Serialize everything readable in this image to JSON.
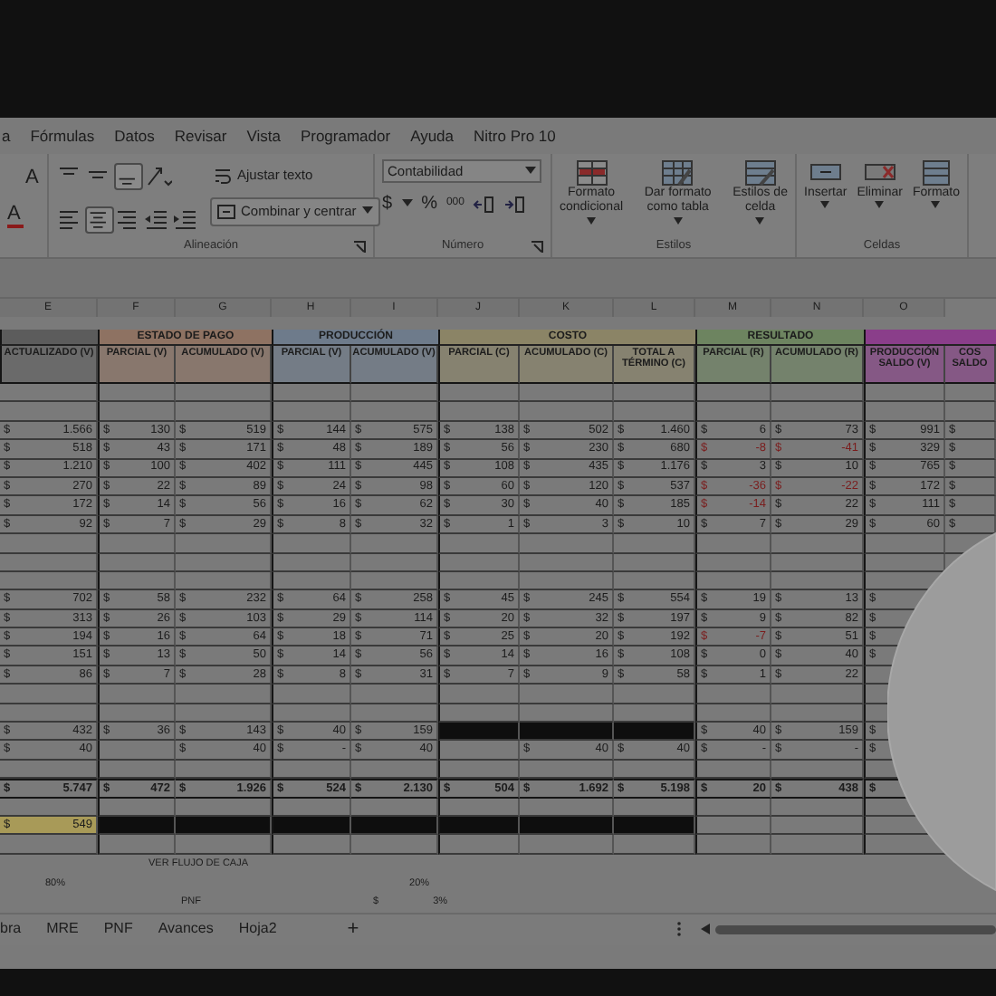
{
  "menu_tabs": [
    "a",
    "Fórmulas",
    "Datos",
    "Revisar",
    "Vista",
    "Programador",
    "Ayuda",
    "Nitro Pro 10"
  ],
  "ribbon": {
    "font_buttons": [
      "A",
      "A"
    ],
    "alignment": {
      "icons": [
        {
          "kind": "top",
          "pressed": false
        },
        {
          "kind": "middle",
          "pressed": false
        },
        {
          "kind": "bottom",
          "pressed": true
        },
        {
          "kind": "orientation",
          "pressed": false
        },
        {
          "kind": "left",
          "pressed": false
        },
        {
          "kind": "center",
          "pressed": true
        },
        {
          "kind": "right",
          "pressed": false
        },
        {
          "kind": "outdent",
          "pressed": false
        },
        {
          "kind": "indent",
          "pressed": false
        }
      ],
      "wrap": "Ajustar texto",
      "merge": "Combinar y centrar",
      "label": "Alineación"
    },
    "number": {
      "format": "Contabilidad",
      "symbols": [
        "$",
        "%",
        "000"
      ],
      "label": "Número"
    },
    "styles": {
      "buttons": [
        [
          "Formato",
          "condicional"
        ],
        [
          "Dar formato",
          "como tabla"
        ],
        [
          "Estilos de",
          "celda"
        ]
      ],
      "label": "Estilos"
    },
    "cells": {
      "buttons": [
        "Insertar",
        "Eliminar",
        "Formato"
      ],
      "label": "Celdas"
    }
  },
  "column_letters": [
    "E",
    "F",
    "G",
    "H",
    "I",
    "J",
    "K",
    "L",
    "M",
    "N",
    "O"
  ],
  "table": {
    "groups": [
      {
        "color": "#5c5c5c",
        "columns": [
          "ACTUALIZADO (V)"
        ]
      },
      {
        "label": "ESTADO DE PAGO",
        "color": "#8e7262",
        "columns": [
          "PARCIAL (V)",
          "ACUMULADO (V)"
        ]
      },
      {
        "label": "PRODUCCIÓN",
        "color": "#6e7b8b",
        "columns": [
          "PARCIAL (V)",
          "ACUMULADO (V)"
        ]
      },
      {
        "label": "COSTO",
        "color": "#8b8466",
        "columns": [
          "PARCIAL (C)",
          "ACUMULADO (C)",
          "TOTAL A TÉRMINO (C)"
        ]
      },
      {
        "label": "RESULTADO",
        "color": "#6d8460",
        "columns": [
          "PARCIAL (R)",
          "ACUMULADO (R)"
        ]
      },
      {
        "color": "#8a3e8a",
        "columns": [
          "PRODUCCIÓN SALDO (V)",
          "COS SALDO"
        ]
      }
    ],
    "rows": [
      {
        "kind": "blank",
        "cells": []
      },
      {
        "kind": "blank",
        "cells": []
      },
      {
        "kind": "data",
        "cells": [
          {
            "symbol": "$",
            "value": "1.566",
            "negative": false
          },
          {
            "symbol": "$",
            "value": "130",
            "negative": false
          },
          {
            "symbol": "$",
            "value": "519",
            "negative": false
          },
          {
            "symbol": "$",
            "value": "144",
            "negative": false
          },
          {
            "symbol": "$",
            "value": "575",
            "negative": false
          },
          {
            "symbol": "$",
            "value": "138",
            "negative": false
          },
          {
            "symbol": "$",
            "value": "502",
            "negative": false
          },
          {
            "symbol": "$",
            "value": "1.460",
            "negative": false
          },
          {
            "symbol": "$",
            "value": "6",
            "negative": false
          },
          {
            "symbol": "$",
            "value": "73",
            "negative": false
          },
          {
            "symbol": "$",
            "value": "991",
            "negative": false
          },
          {
            "symbol": "$",
            "negative": false
          }
        ]
      },
      {
        "kind": "data",
        "cells": [
          {
            "symbol": "$",
            "value": "518",
            "negative": false
          },
          {
            "symbol": "$",
            "value": "43",
            "negative": false
          },
          {
            "symbol": "$",
            "value": "171",
            "negative": false
          },
          {
            "symbol": "$",
            "value": "48",
            "negative": false
          },
          {
            "symbol": "$",
            "value": "189",
            "negative": false
          },
          {
            "symbol": "$",
            "value": "56",
            "negative": false
          },
          {
            "symbol": "$",
            "value": "230",
            "negative": false
          },
          {
            "symbol": "$",
            "value": "680",
            "negative": false
          },
          {
            "symbol": "$",
            "value": "-8",
            "negative": true
          },
          {
            "symbol": "$",
            "value": "-41",
            "negative": true
          },
          {
            "symbol": "$",
            "value": "329",
            "negative": false
          },
          {
            "symbol": "$",
            "negative": false
          }
        ]
      },
      {
        "kind": "data",
        "cells": [
          {
            "symbol": "$",
            "value": "1.210",
            "negative": false
          },
          {
            "symbol": "$",
            "value": "100",
            "negative": false
          },
          {
            "symbol": "$",
            "value": "402",
            "negative": false
          },
          {
            "symbol": "$",
            "value": "111",
            "negative": false
          },
          {
            "symbol": "$",
            "value": "445",
            "negative": false
          },
          {
            "symbol": "$",
            "value": "108",
            "negative": false
          },
          {
            "symbol": "$",
            "value": "435",
            "negative": false
          },
          {
            "symbol": "$",
            "value": "1.176",
            "negative": false
          },
          {
            "symbol": "$",
            "value": "3",
            "negative": false
          },
          {
            "symbol": "$",
            "value": "10",
            "negative": false
          },
          {
            "symbol": "$",
            "value": "765",
            "negative": false
          },
          {
            "symbol": "$",
            "negative": false
          }
        ]
      },
      {
        "kind": "data",
        "cells": [
          {
            "symbol": "$",
            "value": "270",
            "negative": false
          },
          {
            "symbol": "$",
            "value": "22",
            "negative": false
          },
          {
            "symbol": "$",
            "value": "89",
            "negative": false
          },
          {
            "symbol": "$",
            "value": "24",
            "negative": false
          },
          {
            "symbol": "$",
            "value": "98",
            "negative": false
          },
          {
            "symbol": "$",
            "value": "60",
            "negative": false
          },
          {
            "symbol": "$",
            "value": "120",
            "negative": false
          },
          {
            "symbol": "$",
            "value": "537",
            "negative": false
          },
          {
            "symbol": "$",
            "value": "-36",
            "negative": true
          },
          {
            "symbol": "$",
            "value": "-22",
            "negative": true
          },
          {
            "symbol": "$",
            "value": "172",
            "negative": false
          },
          {
            "symbol": "$",
            "negative": false
          }
        ]
      },
      {
        "kind": "data",
        "cells": [
          {
            "symbol": "$",
            "value": "172",
            "negative": false
          },
          {
            "symbol": "$",
            "value": "14",
            "negative": false
          },
          {
            "symbol": "$",
            "value": "56",
            "negative": false
          },
          {
            "symbol": "$",
            "value": "16",
            "negative": false
          },
          {
            "symbol": "$",
            "value": "62",
            "negative": false
          },
          {
            "symbol": "$",
            "value": "30",
            "negative": false
          },
          {
            "symbol": "$",
            "value": "40",
            "negative": false
          },
          {
            "symbol": "$",
            "value": "185",
            "negative": false
          },
          {
            "symbol": "$",
            "value": "-14",
            "negative": true
          },
          {
            "symbol": "$",
            "value": "22",
            "negative": false
          },
          {
            "symbol": "$",
            "value": "111",
            "negative": false
          },
          {
            "symbol": "$",
            "negative": false
          }
        ]
      },
      {
        "kind": "data",
        "cells": [
          {
            "symbol": "$",
            "value": "92",
            "negative": false
          },
          {
            "symbol": "$",
            "value": "7",
            "negative": false
          },
          {
            "symbol": "$",
            "value": "29",
            "negative": false
          },
          {
            "symbol": "$",
            "value": "8",
            "negative": false
          },
          {
            "symbol": "$",
            "value": "32",
            "negative": false
          },
          {
            "symbol": "$",
            "value": "1",
            "negative": false
          },
          {
            "symbol": "$",
            "value": "3",
            "negative": false
          },
          {
            "symbol": "$",
            "value": "10",
            "negative": false
          },
          {
            "symbol": "$",
            "value": "7",
            "negative": false
          },
          {
            "symbol": "$",
            "value": "29",
            "negative": false
          },
          {
            "symbol": "$",
            "value": "60",
            "negative": false
          },
          {
            "symbol": "$",
            "negative": false
          }
        ]
      },
      {
        "kind": "blank",
        "cells": []
      },
      {
        "kind": "blank",
        "cells": []
      },
      {
        "kind": "blank",
        "cells": []
      },
      {
        "kind": "data",
        "cells": [
          {
            "symbol": "$",
            "value": "702",
            "negative": false
          },
          {
            "symbol": "$",
            "value": "58",
            "negative": false
          },
          {
            "symbol": "$",
            "value": "232",
            "negative": false
          },
          {
            "symbol": "$",
            "value": "64",
            "negative": false
          },
          {
            "symbol": "$",
            "value": "258",
            "negative": false
          },
          {
            "symbol": "$",
            "value": "45",
            "negative": false
          },
          {
            "symbol": "$",
            "value": "245",
            "negative": false
          },
          {
            "symbol": "$",
            "value": "554",
            "negative": false
          },
          {
            "symbol": "$",
            "value": "19",
            "negative": false
          },
          {
            "symbol": "$",
            "value": "13",
            "negative": false
          },
          {
            "symbol": "$",
            "negative": false
          }
        ]
      },
      {
        "kind": "data",
        "cells": [
          {
            "symbol": "$",
            "value": "313",
            "negative": false
          },
          {
            "symbol": "$",
            "value": "26",
            "negative": false
          },
          {
            "symbol": "$",
            "value": "103",
            "negative": false
          },
          {
            "symbol": "$",
            "value": "29",
            "negative": false
          },
          {
            "symbol": "$",
            "value": "114",
            "negative": false
          },
          {
            "symbol": "$",
            "value": "20",
            "negative": false
          },
          {
            "symbol": "$",
            "value": "32",
            "negative": false
          },
          {
            "symbol": "$",
            "value": "197",
            "negative": false
          },
          {
            "symbol": "$",
            "value": "9",
            "negative": false
          },
          {
            "symbol": "$",
            "value": "82",
            "negative": false
          },
          {
            "symbol": "$",
            "negative": false
          }
        ]
      },
      {
        "kind": "data",
        "cells": [
          {
            "symbol": "$",
            "value": "194",
            "negative": false
          },
          {
            "symbol": "$",
            "value": "16",
            "negative": false
          },
          {
            "symbol": "$",
            "value": "64",
            "negative": false
          },
          {
            "symbol": "$",
            "value": "18",
            "negative": false
          },
          {
            "symbol": "$",
            "value": "71",
            "negative": false
          },
          {
            "symbol": "$",
            "value": "25",
            "negative": false
          },
          {
            "symbol": "$",
            "value": "20",
            "negative": false
          },
          {
            "symbol": "$",
            "value": "192",
            "negative": false
          },
          {
            "symbol": "$",
            "value": "-7",
            "negative": true
          },
          {
            "symbol": "$",
            "value": "51",
            "negative": false
          },
          {
            "symbol": "$",
            "negative": false
          }
        ]
      },
      {
        "kind": "data",
        "cells": [
          {
            "symbol": "$",
            "value": "151",
            "negative": false
          },
          {
            "symbol": "$",
            "value": "13",
            "negative": false
          },
          {
            "symbol": "$",
            "value": "50",
            "negative": false
          },
          {
            "symbol": "$",
            "value": "14",
            "negative": false
          },
          {
            "symbol": "$",
            "value": "56",
            "negative": false
          },
          {
            "symbol": "$",
            "value": "14",
            "negative": false
          },
          {
            "symbol": "$",
            "value": "16",
            "negative": false
          },
          {
            "symbol": "$",
            "value": "108",
            "negative": false
          },
          {
            "symbol": "$",
            "value": "0",
            "negative": false
          },
          {
            "symbol": "$",
            "value": "40",
            "negative": false
          },
          {
            "symbol": "$",
            "negative": false
          }
        ]
      },
      {
        "kind": "data",
        "cells": [
          {
            "symbol": "$",
            "value": "86",
            "negative": false
          },
          {
            "symbol": "$",
            "value": "7",
            "negative": false
          },
          {
            "symbol": "$",
            "value": "28",
            "negative": false
          },
          {
            "symbol": "$",
            "value": "8",
            "negative": false
          },
          {
            "symbol": "$",
            "value": "31",
            "negative": false
          },
          {
            "symbol": "$",
            "value": "7",
            "negative": false
          },
          {
            "symbol": "$",
            "value": "9",
            "negative": false
          },
          {
            "symbol": "$",
            "value": "58",
            "negative": false
          },
          {
            "symbol": "$",
            "value": "1",
            "negative": false
          },
          {
            "symbol": "$",
            "value": "22",
            "negative": false
          }
        ]
      },
      {
        "kind": "blank",
        "cells": []
      },
      {
        "kind": "blank",
        "cells": []
      },
      {
        "kind": "data",
        "cells": [
          {
            "symbol": "$",
            "value": "432",
            "negative": false
          },
          {
            "symbol": "$",
            "value": "36",
            "negative": false
          },
          {
            "symbol": "$",
            "value": "143",
            "negative": false
          },
          {
            "symbol": "$",
            "value": "40",
            "negative": false
          },
          {
            "symbol": "$",
            "value": "159",
            "negative": false
          },
          {
            "color": "#0e0e0e"
          },
          {
            "color": "#0e0e0e"
          },
          {
            "color": "#0e0e0e"
          },
          {
            "symbol": "$",
            "value": "40",
            "negative": false
          },
          {
            "symbol": "$",
            "value": "159",
            "negative": false
          },
          {
            "symbol": "$",
            "negative": false
          }
        ]
      },
      {
        "kind": "data",
        "cells": [
          {
            "symbol": "$",
            "value": "40",
            "negative": false
          },
          {},
          {
            "symbol": "$",
            "value": "40",
            "negative": false
          },
          {
            "symbol": "$",
            "value": "-",
            "negative": false
          },
          {
            "symbol": "$",
            "value": "40",
            "negative": false
          },
          {},
          {
            "symbol": "$",
            "value": "40",
            "negative": false
          },
          {
            "symbol": "$",
            "value": "40",
            "negative": false
          },
          {
            "symbol": "$",
            "value": "-",
            "negative": false
          },
          {
            "symbol": "$",
            "value": "-",
            "negative": false
          },
          {
            "symbol": "$",
            "negative": false
          }
        ]
      },
      {
        "kind": "blank",
        "cells": []
      },
      {
        "kind": "total",
        "cells": [
          {
            "symbol": "$",
            "value": "5.747",
            "negative": false
          },
          {
            "symbol": "$",
            "value": "472",
            "negative": false
          },
          {
            "symbol": "$",
            "value": "1.926",
            "negative": false
          },
          {
            "symbol": "$",
            "value": "524",
            "negative": false
          },
          {
            "symbol": "$",
            "value": "2.130",
            "negative": false
          },
          {
            "symbol": "$",
            "value": "504",
            "negative": false
          },
          {
            "symbol": "$",
            "value": "1.692",
            "negative": false
          },
          {
            "symbol": "$",
            "value": "5.198",
            "negative": false
          },
          {
            "symbol": "$",
            "value": "20",
            "negative": false
          },
          {
            "symbol": "$",
            "value": "438",
            "negative": false
          },
          {
            "symbol": "$",
            "negative": false
          }
        ]
      },
      {
        "kind": "blank",
        "cells": []
      },
      {
        "kind": "data",
        "cells": [
          {
            "symbol": "$",
            "value": "549",
            "negative": false,
            "color": "#a89a58"
          },
          {
            "color": "#0e0e0e"
          },
          {
            "color": "#0e0e0e"
          },
          {
            "color": "#0e0e0e"
          },
          {
            "color": "#0e0e0e"
          },
          {
            "color": "#0e0e0e"
          },
          {
            "color": "#0e0e0e"
          },
          {
            "color": "#0e0e0e"
          }
        ]
      },
      {
        "kind": "blank",
        "cells": []
      }
    ]
  },
  "notes": [
    [
      "VER FLUJO DE CAJA"
    ],
    [
      "80%",
      "20%"
    ],
    [
      "PNF",
      "$",
      "3%"
    ]
  ],
  "sheet_tabs": [
    {
      "label": "bra",
      "selected": false
    },
    {
      "label": "MRE",
      "selected": false
    },
    {
      "label": "PNF",
      "selected": false
    },
    {
      "label": "Avances",
      "selected": false
    },
    {
      "label": "Hoja2",
      "selected": false
    }
  ],
  "add_sheet": "+"
}
